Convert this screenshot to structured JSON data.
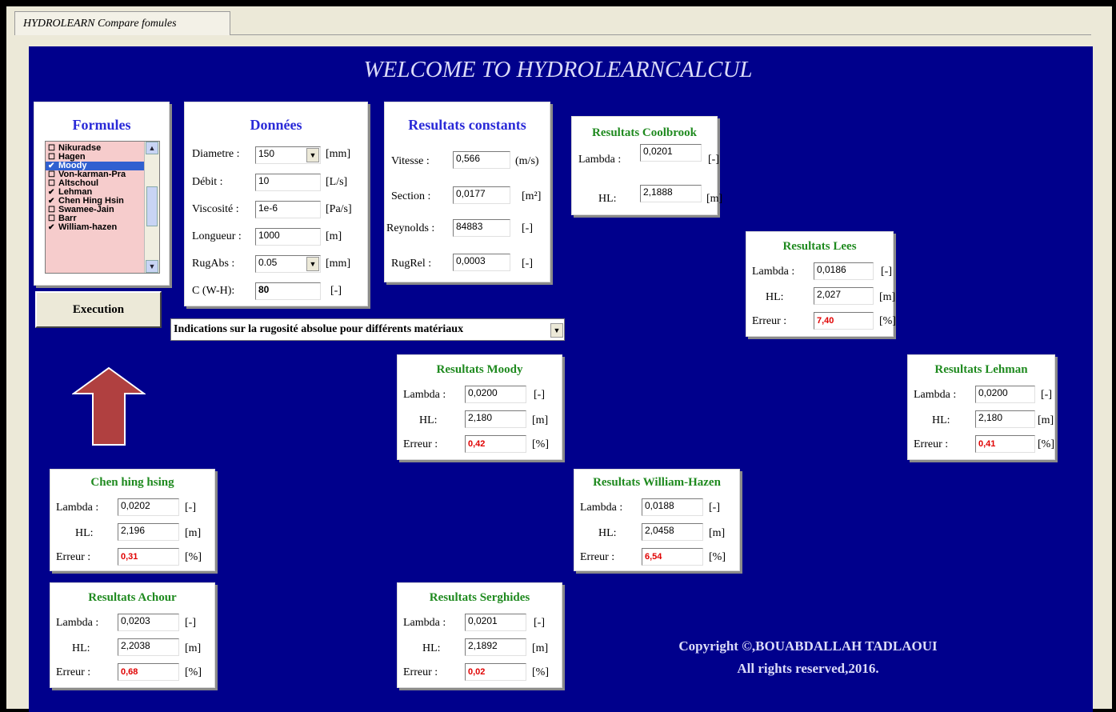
{
  "tab": {
    "label": "HYDROLEARN Compare fomules"
  },
  "welcome": "WELCOME TO HYDROLEARNCALCUL",
  "formules": {
    "title": "Formules",
    "items": [
      {
        "label": "Nikuradse",
        "checked": false,
        "selected": false
      },
      {
        "label": "Hagen",
        "checked": false,
        "selected": false
      },
      {
        "label": "Moody",
        "checked": true,
        "selected": true
      },
      {
        "label": "Von-karman-Pra",
        "checked": false,
        "selected": false
      },
      {
        "label": "Altschoul",
        "checked": false,
        "selected": false
      },
      {
        "label": "Lehman",
        "checked": true,
        "selected": false
      },
      {
        "label": "Chen Hing Hsin",
        "checked": true,
        "selected": false
      },
      {
        "label": "Swamee-Jain",
        "checked": false,
        "selected": false
      },
      {
        "label": "Barr",
        "checked": false,
        "selected": false
      },
      {
        "label": "William-hazen",
        "checked": true,
        "selected": false
      }
    ]
  },
  "execute_label": "Execution",
  "donnees": {
    "title": "Données",
    "diametre_label": "Diametre :",
    "diametre_value": "150",
    "diametre_unit": "[mm]",
    "debit_label": "Débit :",
    "debit_value": "10",
    "debit_unit": "[L/s]",
    "viscosite_label": "Viscosité :",
    "viscosite_value": "1e-6",
    "viscosite_unit": "[Pa/s]",
    "longueur_label": "Longueur :",
    "longueur_value": "1000",
    "longueur_unit": "[m]",
    "rugabs_label": "RugAbs :",
    "rugabs_value": "0.05",
    "rugabs_unit": "[mm]",
    "cwh_label": "C (W-H):",
    "cwh_value": "80",
    "cwh_unit": "[-]"
  },
  "constants": {
    "title": "Resultats constants",
    "vitesse_label": "Vitesse :",
    "vitesse_value": "0,566",
    "vitesse_unit": "(m/s)",
    "section_label": "Section :",
    "section_value": "0,0177",
    "section_unit": "[m²]",
    "reynolds_label": "Reynolds :",
    "reynolds_value": "84883",
    "reynolds_unit": "[-]",
    "rugrel_label": "RugRel :",
    "rugrel_value": "0,0003",
    "rugrel_unit": "[-]"
  },
  "indications_label": "Indications sur la rugosité absolue pour différents matériaux",
  "labels": {
    "lambda": "Lambda :",
    "hl": "HL:",
    "erreur": "Erreur :",
    "u_lambda": "[-]",
    "u_hl": "[m]",
    "u_err": "[%]"
  },
  "coolbrook": {
    "title": "Resultats Coolbrook",
    "lambda": "0,0201",
    "hl": "2,1888"
  },
  "lees": {
    "title": "Resultats Lees",
    "lambda": "0,0186",
    "hl": "2,027",
    "erreur": "7,40"
  },
  "lehman": {
    "title": "Resultats Lehman",
    "lambda": "0,0200",
    "hl": "2,180",
    "erreur": "0,41"
  },
  "moody": {
    "title": "Resultats Moody",
    "lambda": "0,0200",
    "hl": "2,180",
    "erreur": "0,42"
  },
  "chen": {
    "title": "Chen hing hsing",
    "lambda": "0,0202",
    "hl": "2,196",
    "erreur": "0,31"
  },
  "william": {
    "title": "Resultats William-Hazen",
    "lambda": "0,0188",
    "hl": "2,0458",
    "erreur": "6,54"
  },
  "achour": {
    "title": "Resultats Achour",
    "lambda": "0,0203",
    "hl": "2,2038",
    "erreur": "0,68"
  },
  "serghides": {
    "title": "Resultats Serghides",
    "lambda": "0,0201",
    "hl": "2,1892",
    "erreur": "0,02"
  },
  "copyright": {
    "line1": "Copyright ©,BOUABDALLAH TADLAOUI",
    "line2": "All rights reserved,2016."
  },
  "colors": {
    "panel": "#00008c",
    "title_blue": "#2a2ad8",
    "title_green": "#1f8a1f",
    "error_red": "#e00000",
    "list_bg": "#f6cccc",
    "arrow": "#b04040"
  }
}
